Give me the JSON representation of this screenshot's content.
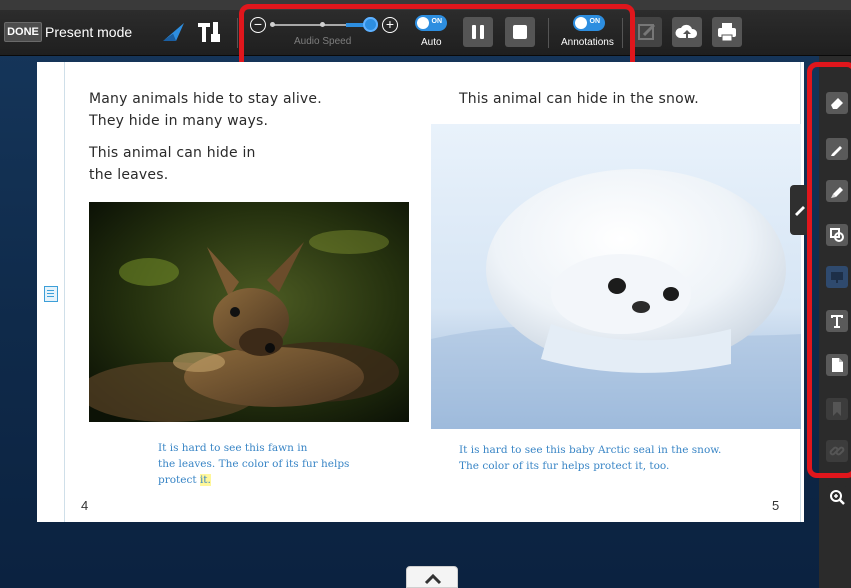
{
  "toolbar": {
    "done_label": "DONE",
    "mode_label": "Present mode",
    "audio": {
      "speed_label": "Audio Speed",
      "speed_level_percent": 100,
      "auto_label": "Auto",
      "auto_toggle": "ON",
      "annotations_label": "Annotations",
      "annotations_toggle": "ON"
    }
  },
  "book": {
    "left_page": {
      "para1": [
        "Many animals hide to stay alive.",
        "They hide in many ways."
      ],
      "para2": [
        "This animal can hide in",
        "the leaves."
      ],
      "caption": [
        "It is hard to see this fawn in",
        "the leaves. The color of its fur helps",
        "protect "
      ],
      "caption_highlight": "it.",
      "page_number": "4"
    },
    "right_page": {
      "para1": "This animal can hide in the snow.",
      "caption": [
        "It is hard to see this baby Arctic seal in the snow.",
        "The color of its fur helps protect it, too."
      ],
      "page_number": "5"
    }
  },
  "side_tools": [
    "eraser-icon",
    "pen-icon",
    "highlighter-icon",
    "shapes-icon",
    "screen-icon",
    "text-icon",
    "note-icon",
    "bookmark-icon",
    "link-icon",
    "zoom-in-icon"
  ],
  "colors": {
    "highlight_red": "#e0161c",
    "toggle_blue": "#2d8ee0",
    "caption_blue": "#3a86c6",
    "background_navy": "#16375c"
  }
}
